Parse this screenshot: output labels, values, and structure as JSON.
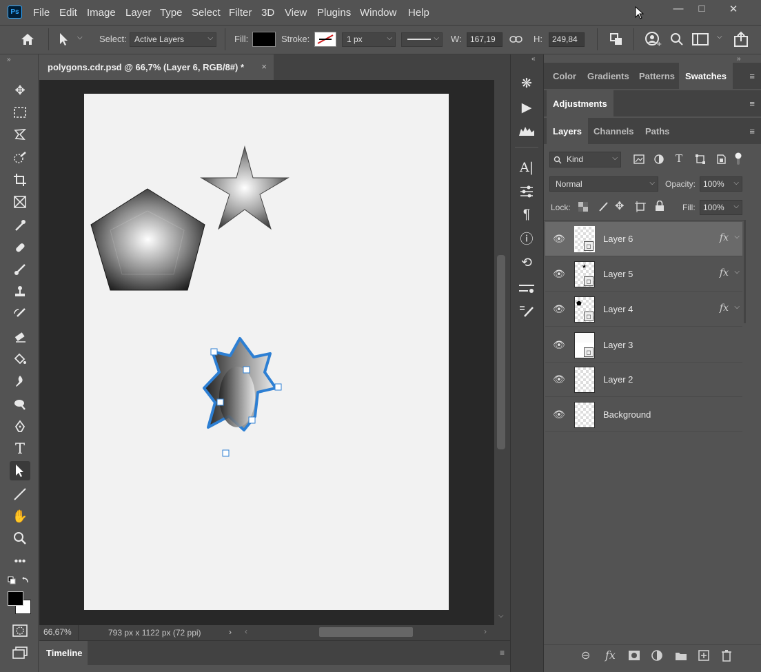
{
  "app": {
    "logo": "Ps"
  },
  "menu": [
    "File",
    "Edit",
    "Image",
    "Layer",
    "Type",
    "Select",
    "Filter",
    "3D",
    "View",
    "Plugins",
    "Window",
    "Help"
  ],
  "window_controls": {
    "minimize": "—",
    "maximize": "□",
    "close": "✕"
  },
  "options": {
    "select_label": "Select:",
    "select_value": "Active Layers",
    "fill_label": "Fill:",
    "fill_color": "#000000",
    "stroke_label": "Stroke:",
    "stroke_width": "1 px",
    "w_label": "W:",
    "w_value": "167,19",
    "h_label": "H:",
    "h_value": "249,84"
  },
  "document": {
    "tab_title": "polygons.cdr.psd @ 66,7% (Layer 6, RGB/8#) *",
    "close_glyph": "×",
    "zoom": "66,67%",
    "doc_info": "793 px x 1122 px (72 ppi)"
  },
  "timeline": {
    "label": "Timeline"
  },
  "panels": {
    "top_tabs": [
      "Color",
      "Gradients",
      "Patterns",
      "Swatches"
    ],
    "top_active": "Swatches",
    "adjustments": "Adjustments",
    "layer_tabs": [
      "Layers",
      "Channels",
      "Paths"
    ],
    "layer_active": "Layers",
    "filter_kind": "Kind",
    "blend_mode": "Normal",
    "opacity_label": "Opacity:",
    "opacity_value": "100%",
    "lock_label": "Lock:",
    "fill_label": "Fill:",
    "fill_value": "100%"
  },
  "layers": [
    {
      "name": "Layer 6",
      "selected": true,
      "fx": "fx"
    },
    {
      "name": "Layer 5",
      "selected": false,
      "fx": "fx"
    },
    {
      "name": "Layer 4",
      "selected": false,
      "fx": "fx"
    },
    {
      "name": "Layer 3",
      "selected": false,
      "fx": ""
    },
    {
      "name": "Layer 2",
      "selected": false,
      "fx": ""
    },
    {
      "name": "Background",
      "selected": false,
      "fx": ""
    }
  ],
  "colors": {
    "accent": "#2d7fd3",
    "foreground": "#000000",
    "background": "#ffffff"
  }
}
